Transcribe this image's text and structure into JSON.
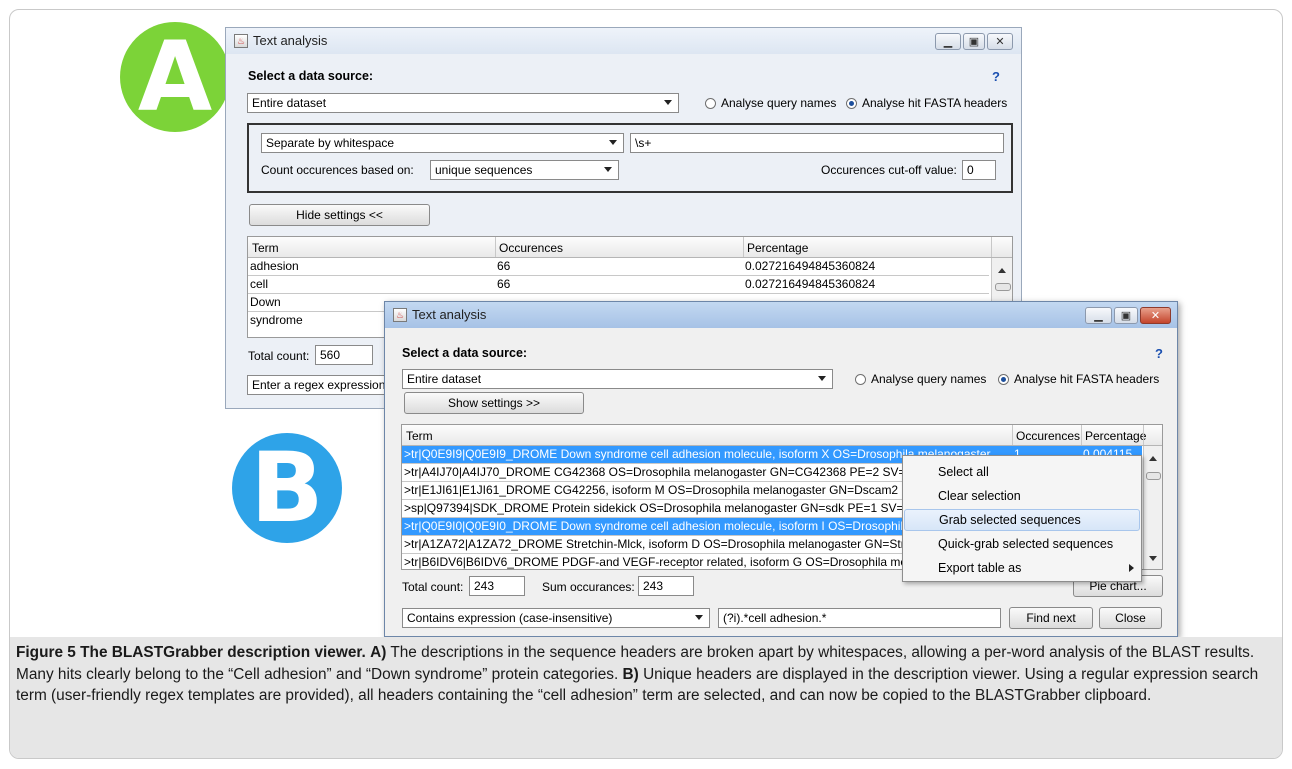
{
  "badges": {
    "a": "A",
    "b": "B"
  },
  "window_a": {
    "title": "Text analysis",
    "help": "?",
    "select_source_label": "Select a data source:",
    "source_value": "Entire dataset",
    "radio_query": "Analyse query names",
    "radio_hit": "Analyse hit FASTA headers",
    "separator_value": "Separate by whitespace",
    "regex_value": "\\s+",
    "count_label": "Count occurences based on:",
    "count_value": "unique sequences",
    "cutoff_label": "Occurences cut-off value:",
    "cutoff_value": "0",
    "hide_settings": "Hide settings <<",
    "table": {
      "headers": [
        "Term",
        "Occurences",
        "Percentage"
      ],
      "rows": [
        [
          "adhesion",
          "66",
          "0.027216494845360824"
        ],
        [
          "cell",
          "66",
          "0.027216494845360824"
        ],
        [
          "Down",
          "",
          ""
        ],
        [
          "syndrome",
          "",
          ""
        ]
      ]
    },
    "total_count_label": "Total count:",
    "total_count_value": "560",
    "regex_combo": "Enter a regex expression"
  },
  "window_b": {
    "title": "Text analysis",
    "help": "?",
    "select_source_label": "Select a data source:",
    "source_value": "Entire dataset",
    "radio_query": "Analyse query names",
    "radio_hit": "Analyse hit FASTA headers",
    "show_settings": "Show settings >>",
    "table": {
      "headers": [
        "Term",
        "Occurences",
        "Percentage"
      ],
      "rows": [
        {
          "term": ">tr|Q0E9I9|Q0E9I9_DROME Down syndrome cell adhesion molecule, isoform X OS=Drosophila melanogaster",
          "occ": "1",
          "pct": "0.004115",
          "selected": true
        },
        {
          "term": ">tr|A4IJ70|A4IJ70_DROME CG42368 OS=Drosophila melanogaster GN=CG42368 PE=2 SV=1",
          "occ": "",
          "pct": "",
          "selected": false
        },
        {
          "term": ">tr|E1JI61|E1JI61_DROME CG42256, isoform M OS=Drosophila melanogaster GN=Dscam2 PE=",
          "occ": "",
          "pct": "",
          "selected": false
        },
        {
          "term": ">sp|Q97394|SDK_DROME Protein sidekick OS=Drosophila melanogaster GN=sdk PE=1 SV=2",
          "occ": "",
          "pct": "",
          "selected": false
        },
        {
          "term": ">tr|Q0E9I0|Q0E9I0_DROME Down syndrome cell adhesion molecule, isoform I OS=Drosophila m",
          "occ": "",
          "pct": "",
          "selected": true
        },
        {
          "term": ">tr|A1ZA72|A1ZA72_DROME Stretchin-Mlck, isoform D OS=Drosophila melanogaster GN=Strn-",
          "occ": "",
          "pct": "",
          "selected": false
        },
        {
          "term": ">tr|B6IDV6|B6IDV6_DROME PDGF-and VEGF-receptor related, isoform G OS=Drosophila melan",
          "occ": "",
          "pct": "",
          "selected": false
        }
      ]
    },
    "total_count_label": "Total count:",
    "total_count_value": "243",
    "sum_label": "Sum occurances:",
    "sum_value": "243",
    "pie_chart": "Pie chart...",
    "filter_value": "Contains expression (case-insensitive)",
    "regex_value": "(?i).*cell adhesion.*",
    "find_next": "Find next",
    "close": "Close"
  },
  "context_menu": {
    "items": [
      "Select all",
      "Clear selection",
      "Grab selected sequences",
      "Quick-grab selected sequences",
      "Export table as"
    ]
  },
  "caption": {
    "figure_label": "Figure 5",
    "title": "The BLASTGrabber description viewer.",
    "a_label": "A)",
    "a_text": "The descriptions in the sequence headers are broken apart by whitespaces, allowing a per-word analysis of the BLAST results. Many hits clearly belong to the “Cell adhesion” and “Down syndrome” protein categories.",
    "b_label": "B)",
    "b_text": "Unique headers are displayed in the description viewer. Using a regular expression search term (user-friendly regex templates are provided), all headers containing the “cell adhesion” term are selected, and can now be copied to the BLASTGrabber clipboard."
  }
}
